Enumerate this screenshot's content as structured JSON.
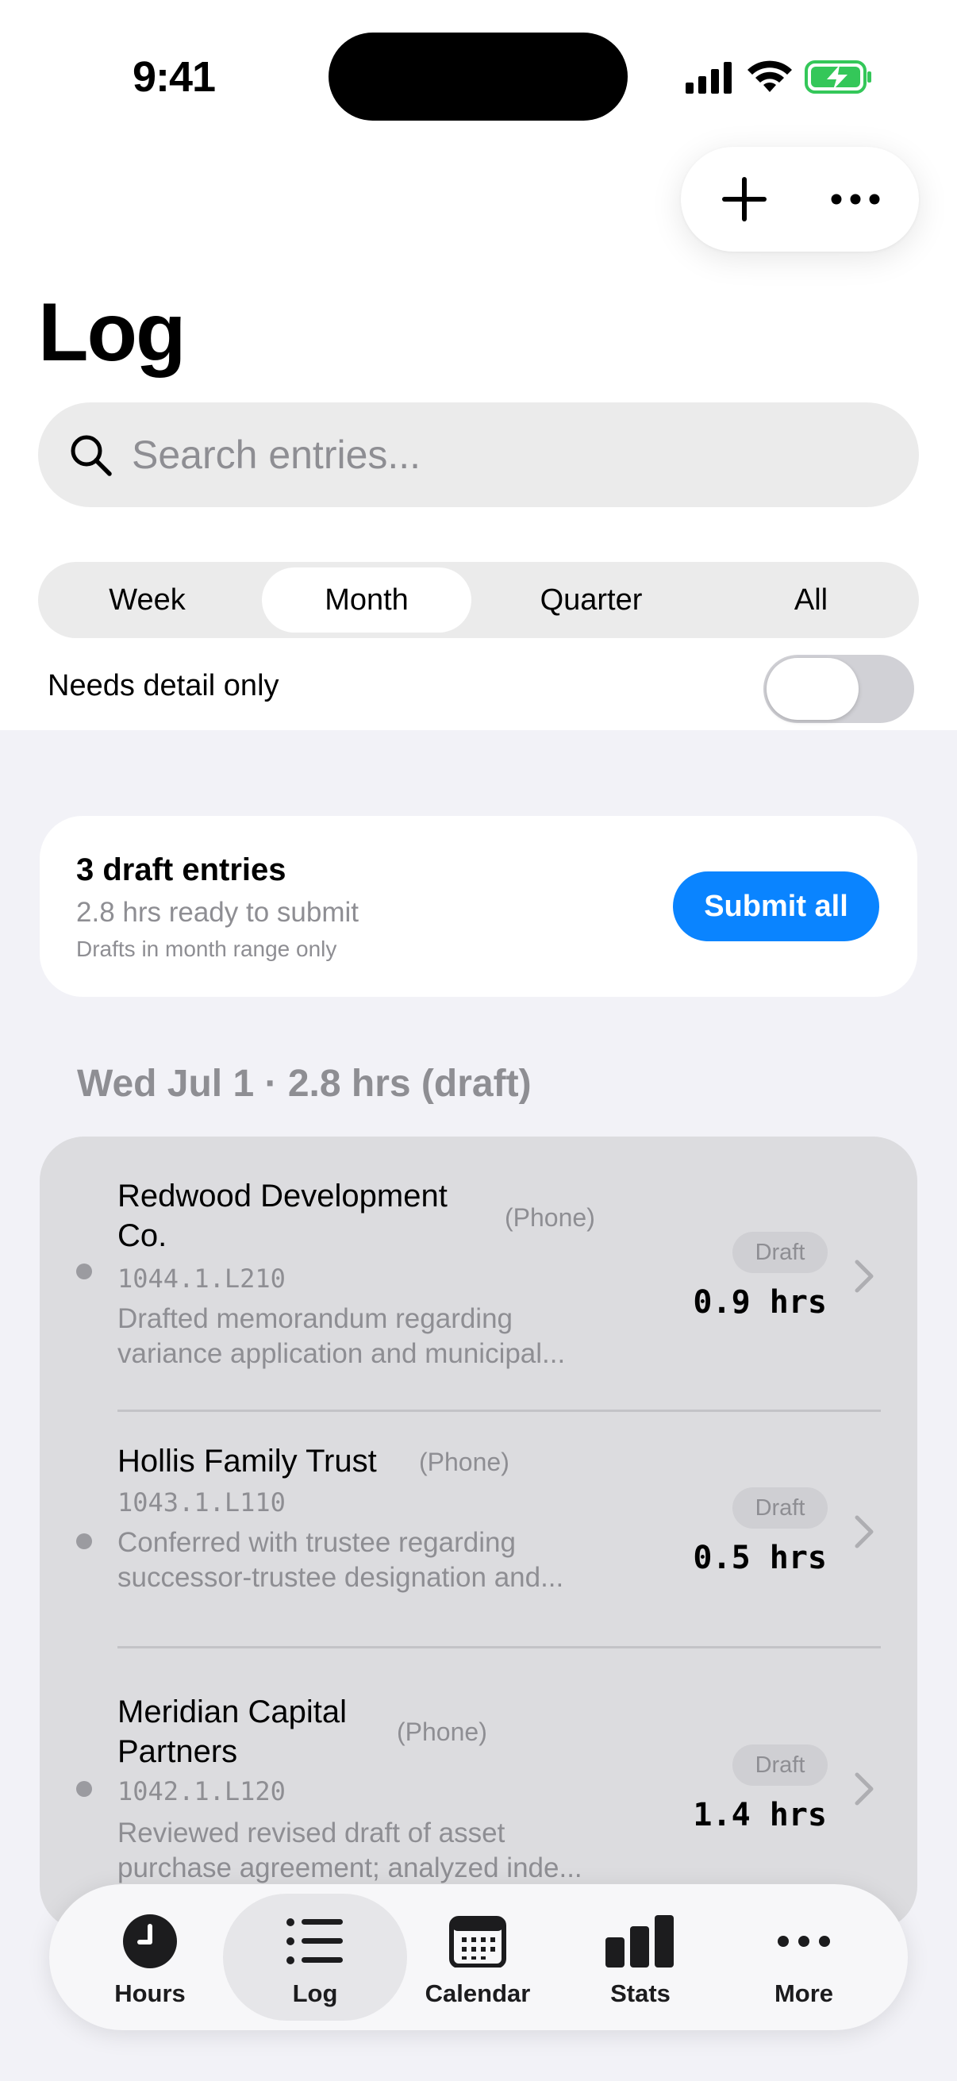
{
  "status_bar": {
    "time": "9:41"
  },
  "header": {
    "title": "Log"
  },
  "search": {
    "placeholder": "Search entries..."
  },
  "range_tabs": [
    {
      "label": "Week",
      "selected": false
    },
    {
      "label": "Month",
      "selected": true
    },
    {
      "label": "Quarter",
      "selected": false
    },
    {
      "label": "All",
      "selected": false
    }
  ],
  "filter": {
    "needs_detail_label": "Needs detail only",
    "needs_detail_on": false
  },
  "draft_summary": {
    "title": "3 draft entries",
    "subtitle": "2.8 hrs ready to submit",
    "note": "Drafts in month range only",
    "submit_label": "Submit all"
  },
  "day_header": "Wed Jul 1 · 2.8 hrs (draft)",
  "entries": [
    {
      "client_line1": "Redwood Development",
      "client_line2": "Co.",
      "via": "(Phone)",
      "code": "1044.1.L210",
      "desc_line1": "Drafted memorandum regarding",
      "desc_line2": "variance application and municipal...",
      "status": "Draft",
      "hours": "0.9 hrs"
    },
    {
      "client_line1": "Hollis Family Trust",
      "client_line2": "",
      "via": "(Phone)",
      "code": "1043.1.L110",
      "desc_line1": "Conferred with trustee regarding",
      "desc_line2": "successor-trustee designation and...",
      "status": "Draft",
      "hours": "0.5 hrs"
    },
    {
      "client_line1": "Meridian Capital",
      "client_line2": "Partners",
      "via": "(Phone)",
      "code": "1042.1.L120",
      "desc_line1": "Reviewed revised draft of asset",
      "desc_line2": "purchase agreement; analyzed inde...",
      "status": "Draft",
      "hours": "1.4 hrs"
    }
  ],
  "tabbar": [
    {
      "label": "Hours",
      "icon": "clock-icon",
      "active": false
    },
    {
      "label": "Log",
      "icon": "list-icon",
      "active": true
    },
    {
      "label": "Calendar",
      "icon": "calendar-icon",
      "active": false
    },
    {
      "label": "Stats",
      "icon": "bar-chart-icon",
      "active": false
    },
    {
      "label": "More",
      "icon": "ellipsis-icon",
      "active": false
    }
  ],
  "colors": {
    "accent": "#0a84ff",
    "battery": "#34c759"
  }
}
